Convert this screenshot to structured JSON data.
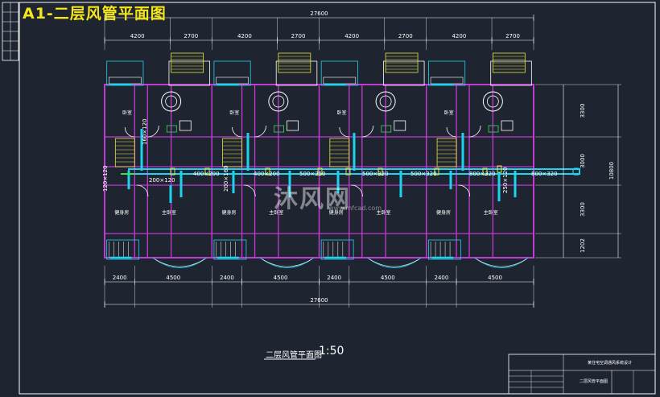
{
  "title": "A1-二层风管平面图",
  "drawing": {
    "name": "二层风管平面图",
    "scale": "1:50"
  },
  "watermark": {
    "main": "沐风网",
    "sub": "www.mfcad.com"
  },
  "dimensions": {
    "overall": "27600",
    "top_segments": [
      "4200",
      "2700",
      "4200",
      "2700",
      "4200",
      "2700",
      "4200",
      "2700"
    ],
    "bottom_segments": [
      "2400",
      "4500",
      "2400",
      "4500",
      "2400",
      "4500",
      "2400",
      "4500"
    ],
    "right_segments": [
      "3300",
      "3000",
      "3300",
      "1202"
    ],
    "right_total": "10800"
  },
  "rooms": {
    "top_bedroom": "卧室",
    "study": "健身房",
    "master_bedroom": "主卧室"
  },
  "ducts": [
    "800×320",
    "800×320",
    "500×320",
    "500×320",
    "500×250",
    "400×200",
    "400×200",
    "200×120",
    "160×120",
    "120×120",
    "200×160",
    "250×120"
  ],
  "title_block": {
    "project": "某住宅空调通风系统设计",
    "drawing": "二层风管平面图"
  },
  "colors": {
    "background": "#1e2430",
    "wall": "#c23bd4",
    "duct": "#1fd3ee",
    "dimension": "#ffffff",
    "title": "#f5e61c",
    "stair": "#e6e63a",
    "green": "#3adf5a"
  }
}
